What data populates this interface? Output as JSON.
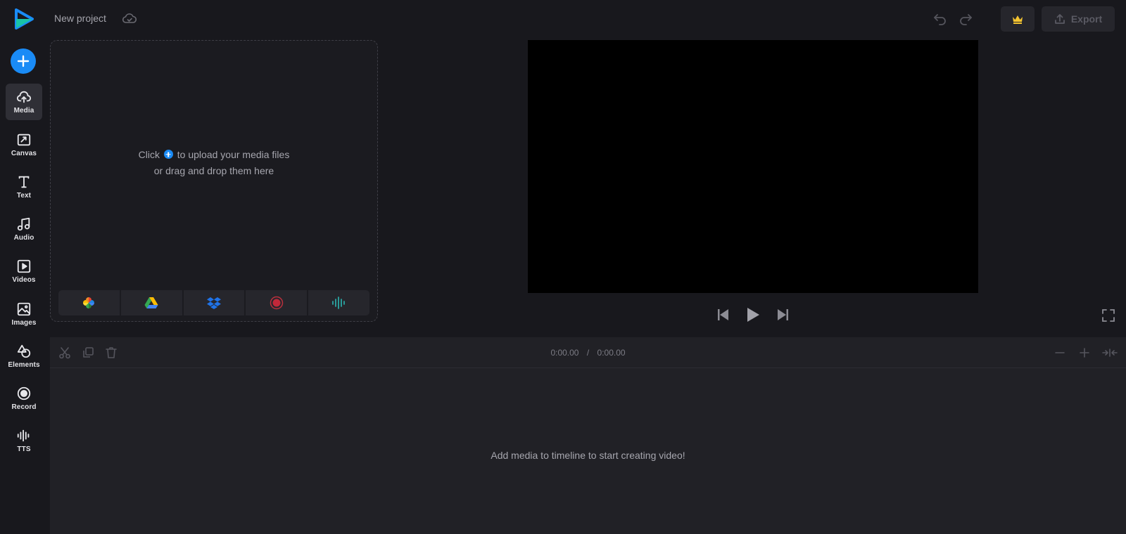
{
  "app": {
    "project_title": "New project"
  },
  "sidebar": {
    "add_button": "add-icon",
    "items": [
      {
        "label": "Media",
        "icon": "upload-cloud-icon",
        "active": true
      },
      {
        "label": "Canvas",
        "icon": "canvas-resize-icon"
      },
      {
        "label": "Text",
        "icon": "text-icon"
      },
      {
        "label": "Audio",
        "icon": "music-note-icon"
      },
      {
        "label": "Videos",
        "icon": "video-play-icon"
      },
      {
        "label": "Images",
        "icon": "image-icon"
      },
      {
        "label": "Elements",
        "icon": "shapes-icon"
      },
      {
        "label": "Record",
        "icon": "record-icon"
      },
      {
        "label": "TTS",
        "icon": "soundwave-icon"
      }
    ]
  },
  "header": {
    "export_label": "Export",
    "icons": [
      "cloud-check-icon",
      "undo-icon",
      "redo-icon",
      "crown-icon",
      "upload-icon"
    ]
  },
  "media_panel": {
    "upload_prefix": "Click",
    "upload_suffix": "to upload your media files",
    "upload_line2": "or drag and drop them here",
    "sources": [
      "google-photos-icon",
      "google-drive-icon",
      "dropbox-icon",
      "record-screen-icon",
      "audio-wave-icon"
    ]
  },
  "player": {
    "controls": [
      "skip-back-icon",
      "play-icon",
      "skip-forward-icon",
      "fullscreen-icon"
    ]
  },
  "timeline": {
    "current_time": "0:00.00",
    "separator": "/",
    "total_time": "0:00.00",
    "empty_message": "Add media to timeline to start creating video!",
    "tools": [
      "cut-icon",
      "duplicate-icon",
      "delete-icon",
      "zoom-out-icon",
      "zoom-in-icon",
      "fit-icon"
    ]
  },
  "colors": {
    "accent": "#1a8bf6",
    "background": "#18181d",
    "timeline_bg": "#212126",
    "crown": "#f4c430"
  }
}
